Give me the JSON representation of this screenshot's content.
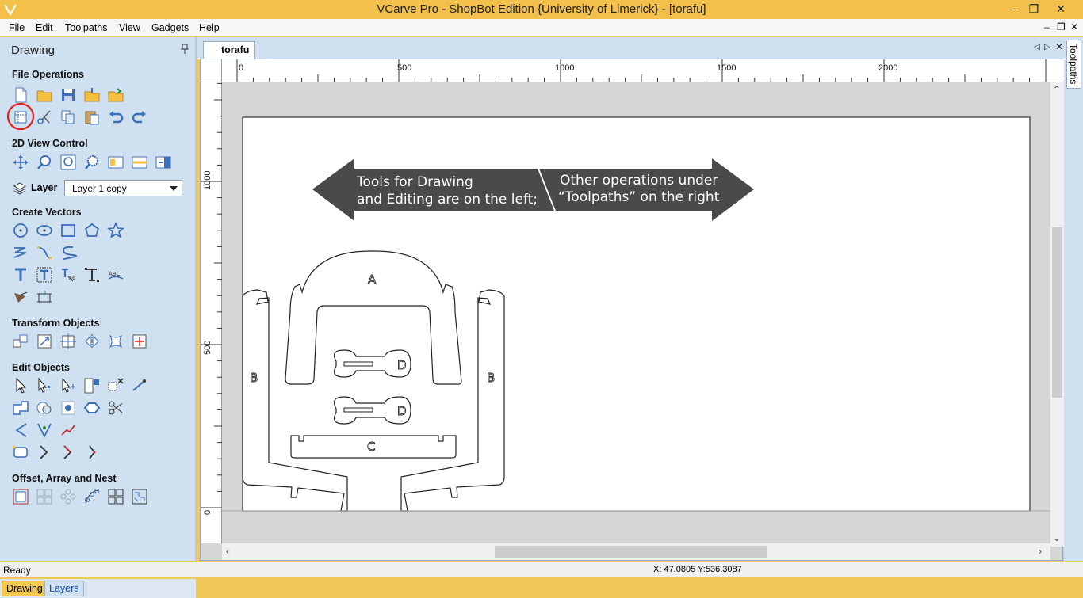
{
  "titlebar": {
    "title": "VCarve Pro - ShopBot Edition {University of Limerick} - [torafu]",
    "minimize": "–",
    "maximize": "❐",
    "close": "✕"
  },
  "menubar": {
    "items": [
      "File",
      "Edit",
      "Toolpaths",
      "View",
      "Gadgets",
      "Help"
    ],
    "mdi_minimize": "–",
    "mdi_restore": "❐",
    "mdi_close": "✕"
  },
  "left_panel": {
    "title": "Drawing",
    "sections": {
      "file_operations": "File Operations",
      "view_control": "2D View Control",
      "create_vectors": "Create Vectors",
      "transform_objects": "Transform Objects",
      "edit_objects": "Edit Objects",
      "offset_array_nest": "Offset, Array and Nest"
    },
    "layer_label": "Layer",
    "layer_value": "Layer 1 copy",
    "bottom_tabs": [
      "Drawing",
      "Layers"
    ]
  },
  "document": {
    "tab_name": "torafu",
    "right_tab": "Toolpaths",
    "tab_prev": "◁",
    "tab_next": "▷",
    "tab_close": "✕"
  },
  "rulers": {
    "horizontal_labels": [
      "0",
      "500",
      "1000",
      "1500",
      "2000"
    ],
    "vertical_labels": [
      "1000",
      "500",
      "0"
    ]
  },
  "annotations": {
    "left_arrow_line1": "Tools for Drawing",
    "left_arrow_line2": "and Editing are on the left;",
    "right_arrow_line1": "Other operations under",
    "right_arrow_line2": "“Toolpaths” on the right"
  },
  "part_labels": {
    "a": "A",
    "b_left": "B",
    "b_right": "B",
    "c": "C",
    "d_top": "D",
    "d_bottom": "D"
  },
  "statusbar": {
    "status": "Ready",
    "coords": "X: 47.0805 Y:536.3087"
  },
  "colors": {
    "titlebar": "#f3c04c",
    "panel": "#cfe0f0",
    "highlight_circle": "#e0201c",
    "arrow_fill": "#4a4a4a"
  }
}
